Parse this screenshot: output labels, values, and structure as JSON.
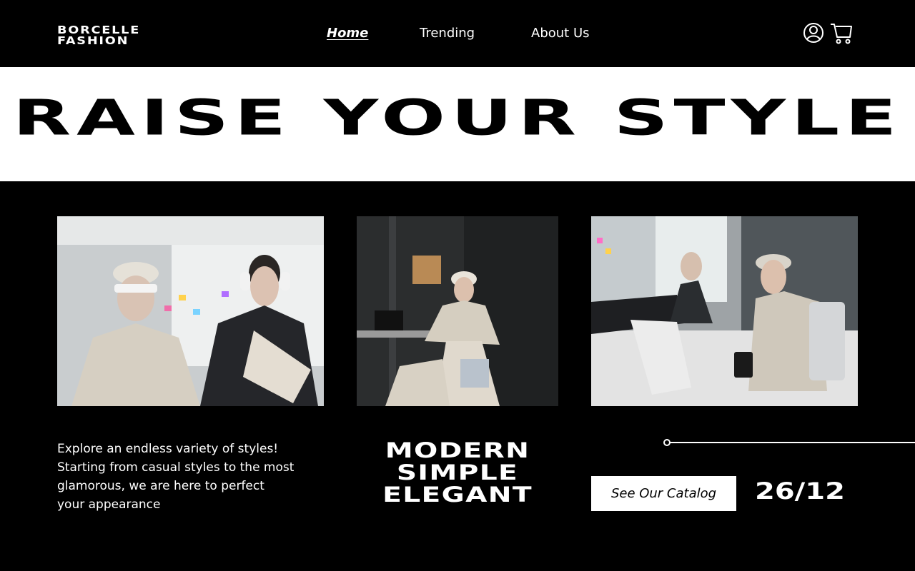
{
  "brand": {
    "line1": "BORCELLE",
    "line2": "FASHION"
  },
  "nav": {
    "items": [
      {
        "label": "Home",
        "active": true
      },
      {
        "label": "Trending",
        "active": false
      },
      {
        "label": "About Us",
        "active": false
      }
    ]
  },
  "header_icons": {
    "account": "user-circle-icon",
    "cart": "cart-icon"
  },
  "hero": {
    "title": "RAISE YOUR STYLE"
  },
  "photos": [
    {
      "name": "photo-two-models-office"
    },
    {
      "name": "photo-model-seated-chair"
    },
    {
      "name": "photo-models-desk-laptop"
    }
  ],
  "description": [
    "Explore an endless variety of styles!",
    "Starting from casual styles to the most",
    "glamorous, we are here to perfect",
    "your appearance"
  ],
  "tagline": [
    "MODERN",
    "SIMPLE",
    "ELEGANT"
  ],
  "cta": {
    "label": "See Our Catalog"
  },
  "date": "26/12",
  "colors": {
    "background": "#000000",
    "hero_background": "#ffffff",
    "text": "#ffffff",
    "button_background": "#ffffff"
  }
}
